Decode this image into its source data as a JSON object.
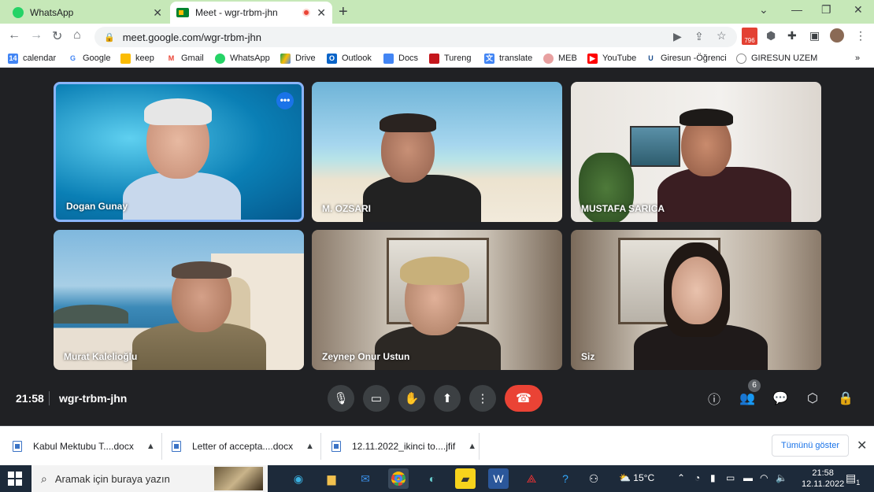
{
  "browser": {
    "tabs": [
      {
        "title": "WhatsApp",
        "active": false
      },
      {
        "title": "Meet - wgr-trbm-jhn",
        "active": true,
        "recording": true
      }
    ],
    "url": "meet.google.com/wgr-trbm-jhn",
    "calendar_badge": "796",
    "bookmarks": [
      {
        "label": "calendar",
        "icon": "calendar-icon"
      },
      {
        "label": "Google",
        "icon": "google-icon"
      },
      {
        "label": "keep",
        "icon": "keep-icon"
      },
      {
        "label": "Gmail",
        "icon": "gmail-icon"
      },
      {
        "label": "WhatsApp",
        "icon": "whatsapp-icon"
      },
      {
        "label": "Drive",
        "icon": "drive-icon"
      },
      {
        "label": "Outlook",
        "icon": "outlook-icon"
      },
      {
        "label": "Docs",
        "icon": "docs-icon"
      },
      {
        "label": "Tureng",
        "icon": "tureng-icon"
      },
      {
        "label": "translate",
        "icon": "translate-icon"
      },
      {
        "label": "MEB",
        "icon": "meb-icon"
      },
      {
        "label": "YouTube",
        "icon": "youtube-icon"
      },
      {
        "label": "Giresun -Öğrenci",
        "icon": "giresun-icon"
      },
      {
        "label": "GIRESUN UZEM",
        "icon": "uzem-icon"
      }
    ]
  },
  "meet": {
    "participants": [
      {
        "name": "Dogan Gunay",
        "active_speaker": true
      },
      {
        "name": "M. OZSARI",
        "active_speaker": false
      },
      {
        "name": "MUSTAFA SARICA",
        "active_speaker": false
      },
      {
        "name": "Murat Kalelioğlu",
        "active_speaker": false
      },
      {
        "name": "Zeynep Onur Ustun",
        "active_speaker": false
      },
      {
        "name": "Siz",
        "active_speaker": false
      }
    ],
    "time": "21:58",
    "meeting_code": "wgr-trbm-jhn",
    "people_count": "6",
    "colors": {
      "active_border": "#8ab4f8",
      "hangup": "#ea4335",
      "background": "#202124"
    }
  },
  "downloads": {
    "items": [
      {
        "name": "Kabul Mektubu T....docx"
      },
      {
        "name": "Letter of accepta....docx"
      },
      {
        "name": "12.11.2022_ikinci to....jfif"
      }
    ],
    "show_all": "Tümünü göster"
  },
  "taskbar": {
    "search_placeholder": "Aramak için buraya yazın",
    "temperature": "15°C",
    "clock_time": "21:58",
    "clock_date": "12.11.2022",
    "notification_count": "1"
  }
}
